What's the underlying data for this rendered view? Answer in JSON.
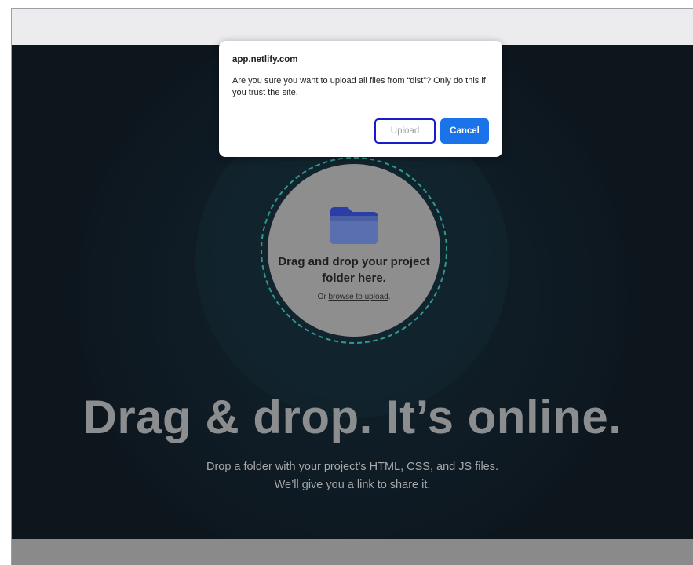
{
  "dialog": {
    "origin": "app.netlify.com",
    "message": "Are you sure you want to upload all files from “dist”? Only do this if you trust the site.",
    "upload_label": "Upload",
    "cancel_label": "Cancel"
  },
  "dropzone": {
    "title": "Drag and drop your project folder here.",
    "sub_prefix": "Or ",
    "sub_link": "browse to upload",
    "sub_suffix": "."
  },
  "hero": {
    "headline": "Drag & drop. It’s online.",
    "subline_1": "Drop a folder with your project’s HTML, CSS, and JS files.",
    "subline_2": "We’ll give you a link to share it."
  },
  "colors": {
    "accent": "#1a73e8",
    "highlight_border": "#1a1ac8",
    "dashed_ring": "#2f9a8a",
    "background": "#0d151d"
  },
  "icons": {
    "folder": "folder-icon"
  }
}
